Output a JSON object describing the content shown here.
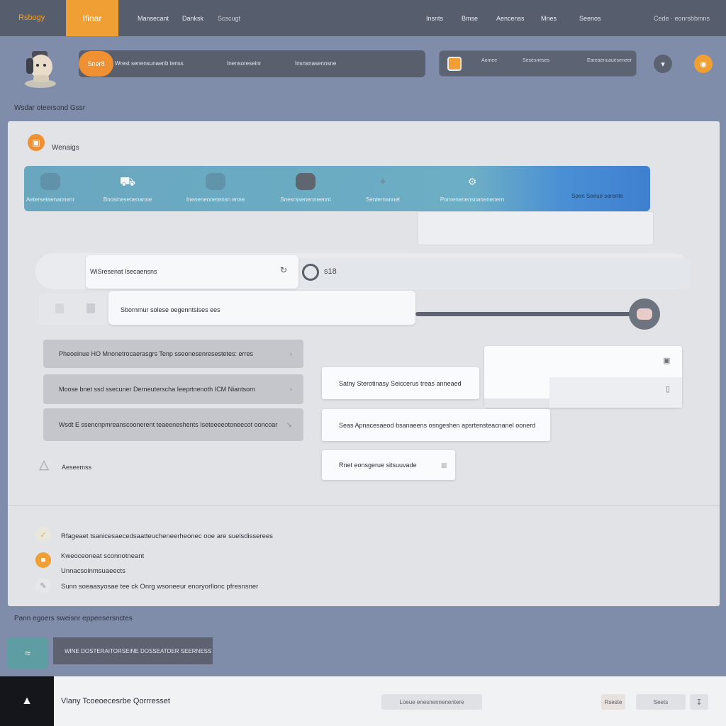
{
  "topbar": {
    "brand": "Rsbogy",
    "active_tab": "Ifinar",
    "nav_left": [
      "Mansecant",
      "Danksk",
      "Scscugt"
    ],
    "nav_right": [
      "Insnts",
      "Bmse",
      "Aencenss",
      "Mnes",
      "Seenos"
    ],
    "account": "Cede · eonrsbbmns"
  },
  "header": {
    "pill": "Sner8",
    "search_segments": [
      "Wrest senensunaenb tenss",
      "Inensoreseinr",
      "Insnsnasennsne"
    ],
    "panel_segments": [
      "Aomee",
      "Sesesneses",
      "Eareaencaueseneer"
    ],
    "round_icon_dark": "chevron-down-icon",
    "round_icon_orange": "bell-icon",
    "breadcrumb": "Wsdar oteersond Gssr"
  },
  "card": {
    "title": "Wenaigs",
    "banner": {
      "items": [
        {
          "icon": "box-icon",
          "label": "Aetersetaenannenr"
        },
        {
          "icon": "car-icon",
          "label": "Bnosinesenenanne"
        },
        {
          "icon": "chat-icon",
          "label": "Inenenennerensn enne"
        },
        {
          "icon": "terminal-icon",
          "label": "Snesrssenenneennt"
        },
        {
          "icon": "wrench-icon",
          "label": "Senternannet"
        },
        {
          "icon": "robot-icon",
          "label": "Ponrenenensnanenenern"
        }
      ],
      "right_label": "Spen Seeue serente"
    },
    "field1": {
      "value": "WiSresenat Isecaensns"
    },
    "toggle_value": "s18",
    "field2": {
      "value": "Sbornmur solese oegenntsises ees"
    },
    "slider_level": 0.95,
    "gray_buttons": [
      "Pheoeinue HO Mnonetrocaerasgrs Tenp sseonesenresestetes: erres",
      "Moose bnet ssd ssecuner Derneuterscha Ieeprtnenoth ICM Niantsorn",
      "Wsdt E ssencnpmreanscoonerent teaeeneshents Iseteeeeotoneecot ooncoar"
    ],
    "small_label": "Aeseemss",
    "white_cards": [
      "Satny Sterotinasy Seiccerus treas anneaed",
      "Seas Apnacesaeod bsanaeens osngeshen apsrtensteacnanel oonerd",
      "Rnet eonsgerue sitsuuvade"
    ],
    "features": [
      "Rfageaet tsanicesaecedsaatteucheneerheonec ooe are suelsdisserees",
      "Kweoceoneat sconnotneant",
      "Unnacsoinmsuaeects",
      "Sunn soeaasyosae tee ck Onrg wsoneeur enoryorllonc pfresnsner"
    ]
  },
  "lower": {
    "label": "Pann egoers sweisnr eppeesersnctes",
    "bar_text": "WINE DOSTERAITORSEINE DOSSEATDER SEERNESS",
    "bottom_title": "Vlany Tcoeoecesrbe Qorrresset",
    "bottom_button": "Loeue enesnennenentere",
    "bottom_small_1": "Rseste",
    "bottom_small_2": "Seets"
  },
  "colors": {
    "accent": "#ef9f33",
    "topbar": "#565d6c",
    "background": "#7f8daa",
    "banner": "#69a7bf",
    "banner_end": "#3f7fd0"
  }
}
